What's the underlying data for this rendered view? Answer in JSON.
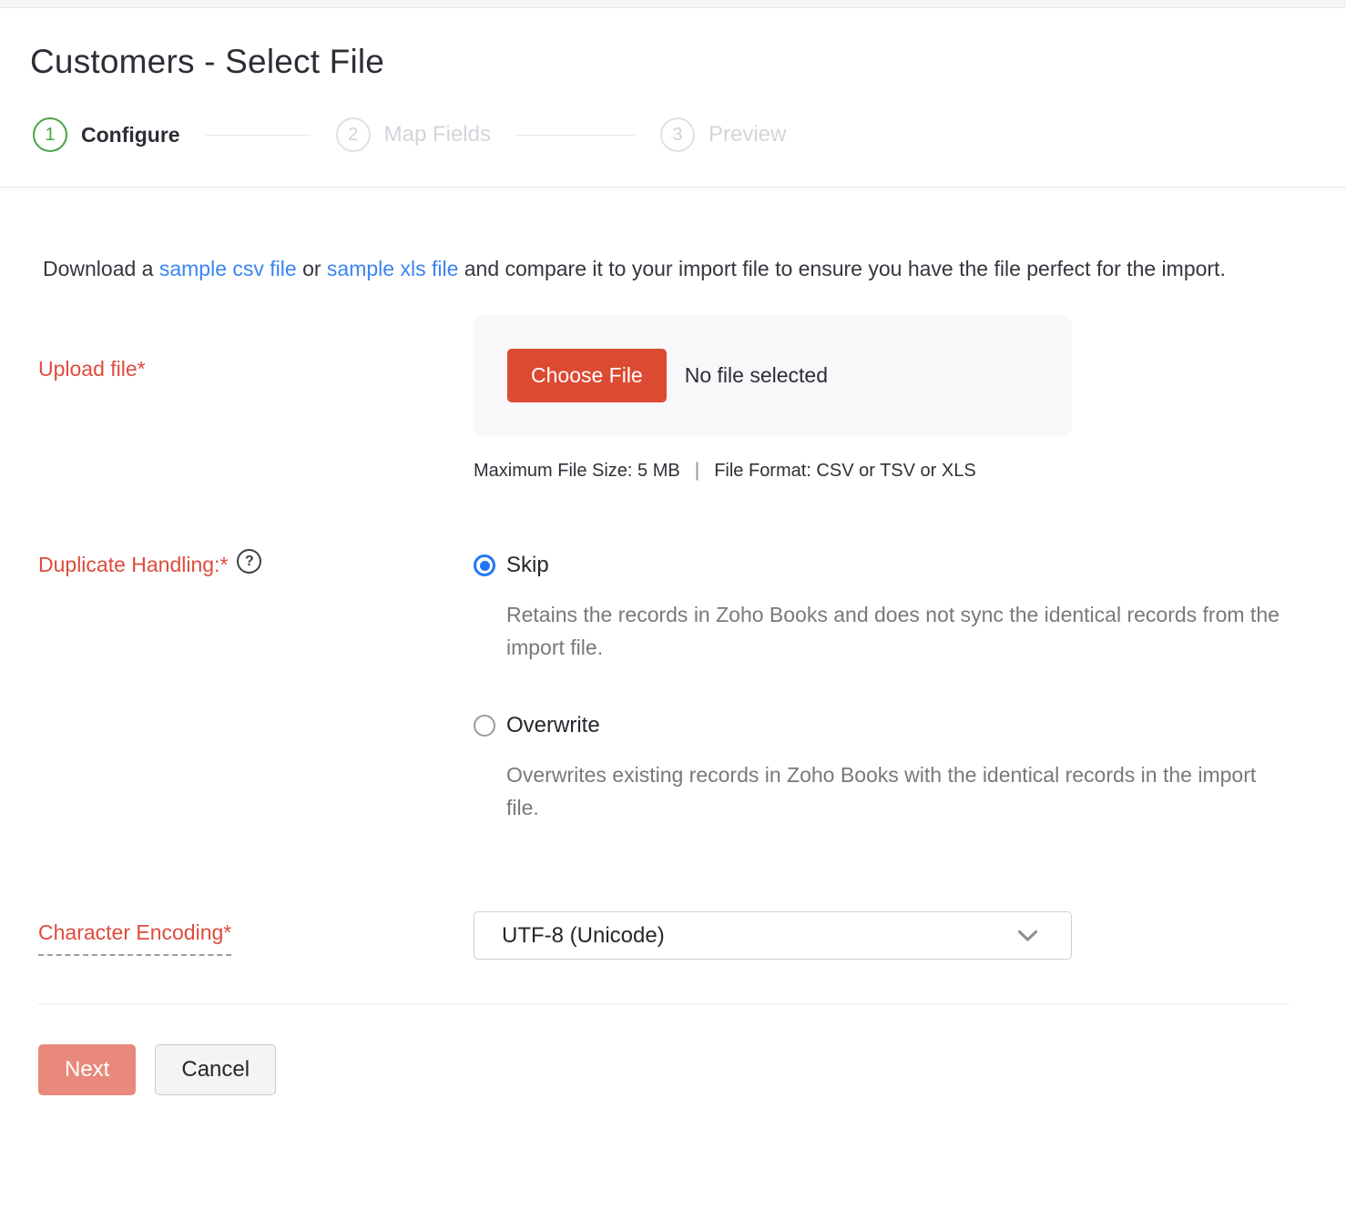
{
  "page": {
    "title": "Customers - Select File"
  },
  "stepper": {
    "steps": [
      {
        "number": "1",
        "label": "Configure",
        "state": "active"
      },
      {
        "number": "2",
        "label": "Map Fields",
        "state": "inactive"
      },
      {
        "number": "3",
        "label": "Preview",
        "state": "inactive"
      }
    ]
  },
  "intro": {
    "part1": "Download a ",
    "csv_link": "sample csv file",
    "part2": " or ",
    "xls_link": "sample xls file",
    "part3": " and compare it to your import file to ensure you have the file perfect for the import."
  },
  "upload": {
    "label": "Upload file*",
    "choose_button": "Choose File",
    "no_file_text": "No file selected",
    "max_size": "Maximum File Size: 5 MB",
    "separator": "|",
    "file_format": "File Format: CSV or TSV or XLS"
  },
  "duplicate_handling": {
    "label": "Duplicate Handling:*",
    "help_glyph": "?",
    "options": [
      {
        "label": "Skip",
        "selected": true,
        "description": "Retains the records in Zoho Books and does not sync the identical records from the import file."
      },
      {
        "label": "Overwrite",
        "selected": false,
        "description": "Overwrites existing records in Zoho Books with the identical records in the import file."
      }
    ]
  },
  "encoding": {
    "label": "Character Encoding*",
    "selected_value": "UTF-8 (Unicode)"
  },
  "actions": {
    "next": "Next",
    "cancel": "Cancel"
  },
  "colors": {
    "step_active_green": "#46a546",
    "link_blue": "#3b85f2",
    "required_label_red": "#df4b3c",
    "choose_button_red": "#dc4a31",
    "next_button_red": "#e8897b",
    "radio_selected_blue": "#2176f5"
  }
}
